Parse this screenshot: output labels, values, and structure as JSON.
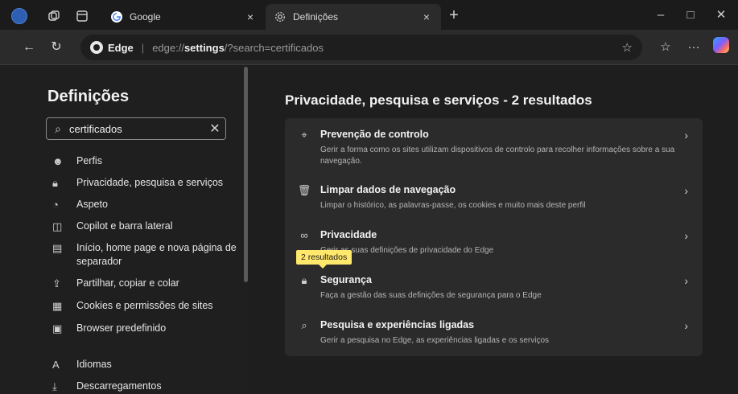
{
  "tabs": [
    {
      "title": "Google",
      "close": "×"
    },
    {
      "title": "Definições",
      "close": "×"
    }
  ],
  "window": {
    "new_tab": "+",
    "minimize": "–",
    "maximize": "□",
    "close": "✕"
  },
  "address": {
    "brand": "Edge",
    "separator": "|",
    "url_prefix": "edge://",
    "url_host": "settings",
    "url_rest": "/?search=certificados"
  },
  "sidebar": {
    "title": "Definições",
    "search_value": "certificados",
    "items": [
      {
        "label": "Perfis",
        "icon": "profile-icon"
      },
      {
        "label": "Privacidade, pesquisa e serviços",
        "icon": "lock-icon"
      },
      {
        "label": "Aspeto",
        "icon": "appearance-icon"
      },
      {
        "label": "Copilot e barra lateral",
        "icon": "sidebar-icon"
      },
      {
        "label": "Início, home page e nova página de separador",
        "icon": "home-page-icon"
      },
      {
        "label": "Partilhar, copiar e colar",
        "icon": "share-icon"
      },
      {
        "label": "Cookies e permissões de sites",
        "icon": "cookies-icon"
      },
      {
        "label": "Browser predefinido",
        "icon": "default-browser-icon"
      },
      {
        "label": "Idiomas",
        "icon": "languages-icon"
      },
      {
        "label": "Descarregamentos",
        "icon": "download-icon"
      }
    ]
  },
  "main": {
    "title": "Privacidade, pesquisa e serviços - 2 resultados",
    "results": [
      {
        "title": "Prevenção de controlo",
        "desc": "Gerir a forma como os sites utilizam dispositivos de controlo para recolher informações sobre a sua navegação.",
        "icon": "tracking-icon"
      },
      {
        "title": "Limpar dados de navegação",
        "desc": "Limpar o histórico, as palavras-passe, os cookies e muito mais deste perfil",
        "icon": "trash-icon"
      },
      {
        "title": "Privacidade",
        "desc": "Gerir as suas definições de privacidade do Edge",
        "icon": "glasses-icon"
      },
      {
        "title": "Segurança",
        "desc": "Faça a gestão das suas definições de segurança para o Edge",
        "icon": "lock-icon"
      },
      {
        "title": "Pesquisa e experiências ligadas",
        "desc": "Gerir a pesquisa no Edge, as experiências ligadas e os serviços",
        "icon": "search-icon"
      }
    ],
    "tooltip": "2 resultados"
  }
}
